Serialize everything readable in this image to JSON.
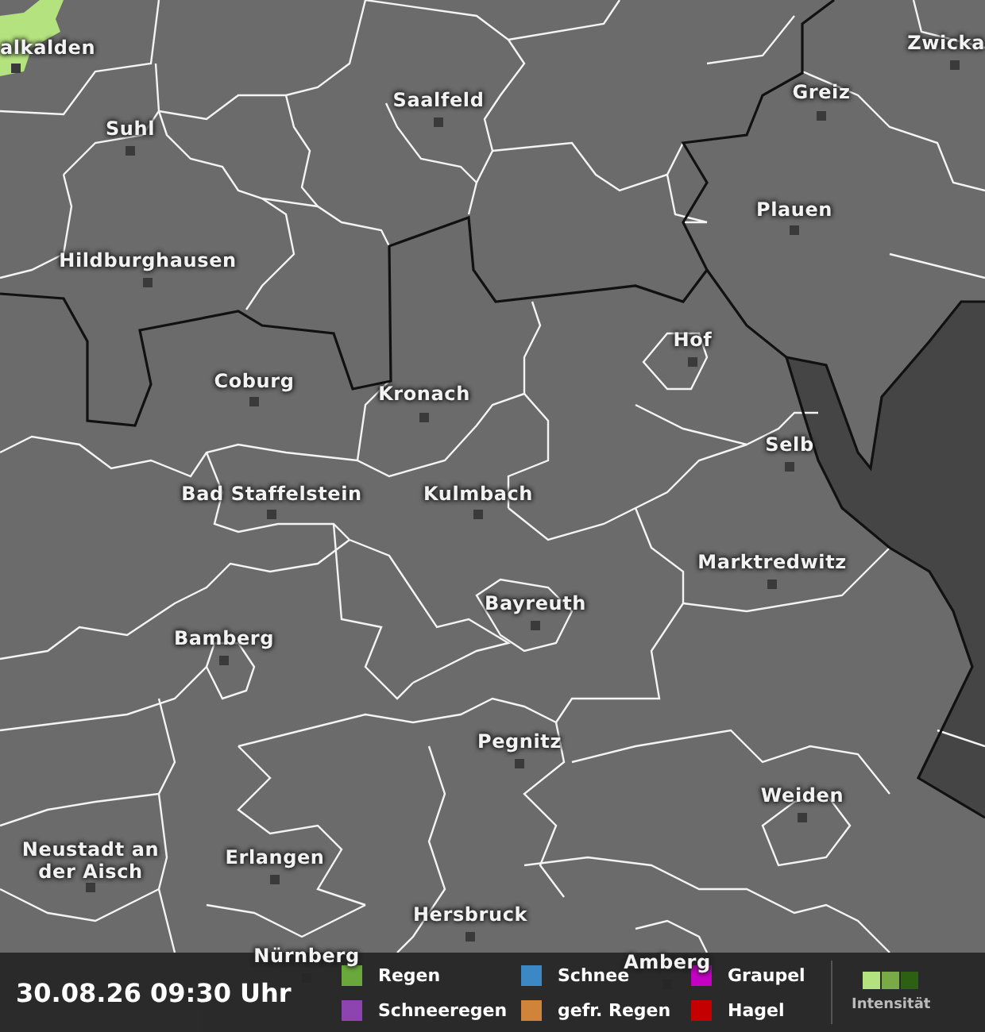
{
  "map": {
    "cities": [
      {
        "name": "alkalden"
      },
      {
        "name": "Suhl"
      },
      {
        "name": "Saalfeld"
      },
      {
        "name": "Greiz"
      },
      {
        "name": "Zwicka"
      },
      {
        "name": "Hildburghausen"
      },
      {
        "name": "Plauen"
      },
      {
        "name": "Hof"
      },
      {
        "name": "Coburg"
      },
      {
        "name": "Kronach"
      },
      {
        "name": "Selb"
      },
      {
        "name": "Bad Staffelstein"
      },
      {
        "name": "Kulmbach"
      },
      {
        "name": "Marktredwitz"
      },
      {
        "name": "Bayreuth"
      },
      {
        "name": "Bamberg"
      },
      {
        "name": "Pegnitz"
      },
      {
        "name": "Weiden"
      },
      {
        "name": "Neustadt an der Aisch"
      },
      {
        "name": "Erlangen"
      },
      {
        "name": "Hersbruck"
      },
      {
        "name": "Nürnberg"
      },
      {
        "name": "Amberg"
      }
    ]
  },
  "footer": {
    "timestamp": "30.08.26 09:30 Uhr",
    "legend": [
      {
        "label": "Regen",
        "color": "#6aa83c"
      },
      {
        "label": "Schneeregen",
        "color": "#8e44b0"
      },
      {
        "label": "Schnee",
        "color": "#3c88c4"
      },
      {
        "label": "gefr. Regen",
        "color": "#d0843a"
      },
      {
        "label": "Graupel",
        "color": "#c400c4"
      },
      {
        "label": "Hagel",
        "color": "#c40000"
      }
    ],
    "intensity": {
      "label": "Intensität",
      "levels": [
        {
          "color": "#b4e27e"
        },
        {
          "color": "#78aa46"
        },
        {
          "color": "#2e6014"
        }
      ]
    }
  }
}
